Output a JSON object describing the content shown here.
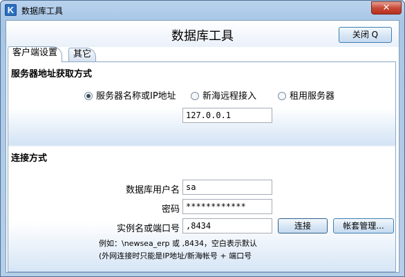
{
  "window": {
    "title": "数据库工具",
    "app_icon_letter": "K",
    "close_glyph": "✕"
  },
  "dialog": {
    "title": "数据库工具",
    "close_button_label": "关闭 Q"
  },
  "tabs": [
    {
      "label": "客户端设置",
      "active": true
    },
    {
      "label": "其它",
      "active": false
    }
  ],
  "server_section": {
    "title": "服务器地址获取方式",
    "options": [
      {
        "label": "服务器名称或IP地址",
        "selected": true
      },
      {
        "label": "新海远程接入",
        "selected": false
      },
      {
        "label": "租用服务器",
        "selected": false
      }
    ],
    "address_value": "127.0.0.1"
  },
  "connect_section": {
    "title": "连接方式",
    "username_label": "数据库用户名",
    "username_value": "sa",
    "password_label": "密码",
    "password_value": "************",
    "instance_label": "实例名或端口号",
    "instance_value": ",8434",
    "connect_button": "连接",
    "account_button": "帐套管理...",
    "hint_line1": "例如：\\newsea_erp 或 ,8434，空白表示默认",
    "hint_line2": "(外网连接时只能是IP地址/新海帐号 + 端口号"
  }
}
